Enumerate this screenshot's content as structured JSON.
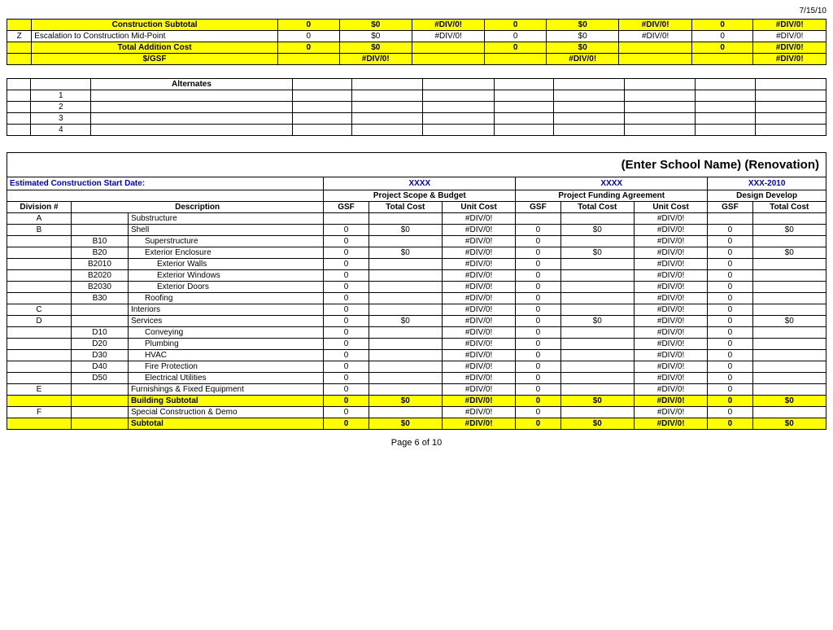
{
  "page": {
    "date": "7/15/10",
    "footer": "Page 6 of 10"
  },
  "school_name": "(Enter School Name) (Renovation)",
  "top_table": {
    "rows": [
      {
        "label": "Construction Subtotal",
        "yellow": true,
        "bold": true,
        "cols": [
          "0",
          "$0",
          "#DIV/0!",
          "0",
          "$0",
          "#DIV/0!",
          "0",
          "#DIV/0!"
        ]
      },
      {
        "prefix": "Z",
        "label": "Escalation to Construction Mid-Point",
        "yellow": false,
        "bold": false,
        "cols": [
          "0",
          "$0",
          "#DIV/0!",
          "0",
          "$0",
          "#DIV/0!",
          "0",
          "#DIV/0!"
        ]
      },
      {
        "label": "Total Addition Cost",
        "yellow": true,
        "bold": true,
        "cols": [
          "0",
          "$0",
          "",
          "0",
          "$0",
          "",
          "0",
          "#DIV/0!"
        ]
      },
      {
        "label": "$/GSF",
        "yellow": true,
        "bold": true,
        "sub": true,
        "cols": [
          "",
          "#DIV/0!",
          "",
          "",
          "#DIV/0!",
          "",
          "",
          "#DIV/0!"
        ]
      }
    ]
  },
  "alternates": {
    "title": "Alternates",
    "items": [
      "1",
      "2",
      "3",
      "4"
    ]
  },
  "estimated_label": "Estimated Construction Start Date:",
  "col_groups": [
    {
      "label": "XXXX",
      "span": 3
    },
    {
      "label": "XXXX",
      "span": 3
    },
    {
      "label": "XXX-2010",
      "span": 2
    }
  ],
  "section_headers": [
    {
      "label": "Project Scope & Budget",
      "span": 3
    },
    {
      "label": "Project Funding Agreement",
      "span": 3
    },
    {
      "label": "Design Develop",
      "span": 2
    }
  ],
  "col_labels": {
    "div_num": "Division #",
    "desc": "Description",
    "gsf": "GSF",
    "total_cost": "Total Cost",
    "unit_cost": "Unit Cost"
  },
  "data_rows": [
    {
      "id": "A",
      "code": "",
      "desc": "Substructure",
      "yellow": false,
      "bold": false,
      "indent": 0,
      "c1_gsf": "",
      "c1_tc": "",
      "c1_uc": "#DIV/0!",
      "c2_gsf": "",
      "c2_tc": "",
      "c2_uc": "#DIV/0!",
      "c3_gsf": "",
      "c3_tc": ""
    },
    {
      "id": "B",
      "code": "",
      "desc": "Shell",
      "yellow": false,
      "bold": false,
      "indent": 0,
      "c1_gsf": "0",
      "c1_tc": "$0",
      "c1_uc": "#DIV/0!",
      "c2_gsf": "0",
      "c2_tc": "$0",
      "c2_uc": "#DIV/0!",
      "c3_gsf": "0",
      "c3_tc": "$0"
    },
    {
      "id": "",
      "code": "B10",
      "desc": "Superstructure",
      "yellow": false,
      "bold": false,
      "indent": 1,
      "c1_gsf": "0",
      "c1_tc": "",
      "c1_uc": "#DIV/0!",
      "c2_gsf": "0",
      "c2_tc": "",
      "c2_uc": "#DIV/0!",
      "c3_gsf": "0",
      "c3_tc": ""
    },
    {
      "id": "",
      "code": "B20",
      "desc": "Exterior Enclosure",
      "yellow": false,
      "bold": false,
      "indent": 1,
      "c1_gsf": "0",
      "c1_tc": "$0",
      "c1_uc": "#DIV/0!",
      "c2_gsf": "0",
      "c2_tc": "$0",
      "c2_uc": "#DIV/0!",
      "c3_gsf": "0",
      "c3_tc": "$0"
    },
    {
      "id": "",
      "code": "B2010",
      "desc": "Exterior Walls",
      "yellow": false,
      "bold": false,
      "indent": 2,
      "c1_gsf": "0",
      "c1_tc": "",
      "c1_uc": "#DIV/0!",
      "c2_gsf": "0",
      "c2_tc": "",
      "c2_uc": "#DIV/0!",
      "c3_gsf": "0",
      "c3_tc": ""
    },
    {
      "id": "",
      "code": "B2020",
      "desc": "Exterior Windows",
      "yellow": false,
      "bold": false,
      "indent": 2,
      "c1_gsf": "0",
      "c1_tc": "",
      "c1_uc": "#DIV/0!",
      "c2_gsf": "0",
      "c2_tc": "",
      "c2_uc": "#DIV/0!",
      "c3_gsf": "0",
      "c3_tc": ""
    },
    {
      "id": "",
      "code": "B2030",
      "desc": "Exterior Doors",
      "yellow": false,
      "bold": false,
      "indent": 2,
      "c1_gsf": "0",
      "c1_tc": "",
      "c1_uc": "#DIV/0!",
      "c2_gsf": "0",
      "c2_tc": "",
      "c2_uc": "#DIV/0!",
      "c3_gsf": "0",
      "c3_tc": ""
    },
    {
      "id": "",
      "code": "B30",
      "desc": "Roofing",
      "yellow": false,
      "bold": false,
      "indent": 1,
      "c1_gsf": "0",
      "c1_tc": "",
      "c1_uc": "#DIV/0!",
      "c2_gsf": "0",
      "c2_tc": "",
      "c2_uc": "#DIV/0!",
      "c3_gsf": "0",
      "c3_tc": ""
    },
    {
      "id": "C",
      "code": "",
      "desc": "Interiors",
      "yellow": false,
      "bold": false,
      "indent": 0,
      "c1_gsf": "0",
      "c1_tc": "",
      "c1_uc": "#DIV/0!",
      "c2_gsf": "0",
      "c2_tc": "",
      "c2_uc": "#DIV/0!",
      "c3_gsf": "0",
      "c3_tc": ""
    },
    {
      "id": "D",
      "code": "",
      "desc": "Services",
      "yellow": false,
      "bold": false,
      "indent": 0,
      "c1_gsf": "0",
      "c1_tc": "$0",
      "c1_uc": "#DIV/0!",
      "c2_gsf": "0",
      "c2_tc": "$0",
      "c2_uc": "#DIV/0!",
      "c3_gsf": "0",
      "c3_tc": "$0"
    },
    {
      "id": "",
      "code": "D10",
      "desc": "Conveying",
      "yellow": false,
      "bold": false,
      "indent": 1,
      "c1_gsf": "0",
      "c1_tc": "",
      "c1_uc": "#DIV/0!",
      "c2_gsf": "0",
      "c2_tc": "",
      "c2_uc": "#DIV/0!",
      "c3_gsf": "0",
      "c3_tc": ""
    },
    {
      "id": "",
      "code": "D20",
      "desc": "Plumbing",
      "yellow": false,
      "bold": false,
      "indent": 1,
      "c1_gsf": "0",
      "c1_tc": "",
      "c1_uc": "#DIV/0!",
      "c2_gsf": "0",
      "c2_tc": "",
      "c2_uc": "#DIV/0!",
      "c3_gsf": "0",
      "c3_tc": ""
    },
    {
      "id": "",
      "code": "D30",
      "desc": "HVAC",
      "yellow": false,
      "bold": false,
      "indent": 1,
      "c1_gsf": "0",
      "c1_tc": "",
      "c1_uc": "#DIV/0!",
      "c2_gsf": "0",
      "c2_tc": "",
      "c2_uc": "#DIV/0!",
      "c3_gsf": "0",
      "c3_tc": ""
    },
    {
      "id": "",
      "code": "D40",
      "desc": "Fire Protection",
      "yellow": false,
      "bold": false,
      "indent": 1,
      "c1_gsf": "0",
      "c1_tc": "",
      "c1_uc": "#DIV/0!",
      "c2_gsf": "0",
      "c2_tc": "",
      "c2_uc": "#DIV/0!",
      "c3_gsf": "0",
      "c3_tc": ""
    },
    {
      "id": "",
      "code": "D50",
      "desc": "Electrical Utilities",
      "yellow": false,
      "bold": false,
      "indent": 1,
      "c1_gsf": "0",
      "c1_tc": "",
      "c1_uc": "#DIV/0!",
      "c2_gsf": "0",
      "c2_tc": "",
      "c2_uc": "#DIV/0!",
      "c3_gsf": "0",
      "c3_tc": ""
    },
    {
      "id": "E",
      "code": "",
      "desc": "Furnishings & Fixed Equipment",
      "yellow": false,
      "bold": false,
      "indent": 0,
      "c1_gsf": "0",
      "c1_tc": "",
      "c1_uc": "#DIV/0!",
      "c2_gsf": "0",
      "c2_tc": "",
      "c2_uc": "#DIV/0!",
      "c3_gsf": "0",
      "c3_tc": ""
    },
    {
      "id": "",
      "code": "",
      "desc": "Building Subtotal",
      "yellow": true,
      "bold": true,
      "indent": 0,
      "c1_gsf": "0",
      "c1_tc": "$0",
      "c1_uc": "#DIV/0!",
      "c2_gsf": "0",
      "c2_tc": "$0",
      "c2_uc": "#DIV/0!",
      "c3_gsf": "0",
      "c3_tc": "$0"
    },
    {
      "id": "F",
      "code": "",
      "desc": "Special Construction & Demo",
      "yellow": false,
      "bold": false,
      "indent": 0,
      "c1_gsf": "0",
      "c1_tc": "",
      "c1_uc": "#DIV/0!",
      "c2_gsf": "0",
      "c2_tc": "",
      "c2_uc": "#DIV/0!",
      "c3_gsf": "0",
      "c3_tc": ""
    },
    {
      "id": "",
      "code": "",
      "desc": "Subtotal",
      "yellow": true,
      "bold": true,
      "indent": 0,
      "c1_gsf": "0",
      "c1_tc": "$0",
      "c1_uc": "#DIV/0!",
      "c2_gsf": "0",
      "c2_tc": "$0",
      "c2_uc": "#DIV/0!",
      "c3_gsf": "0",
      "c3_tc": "$0"
    }
  ]
}
